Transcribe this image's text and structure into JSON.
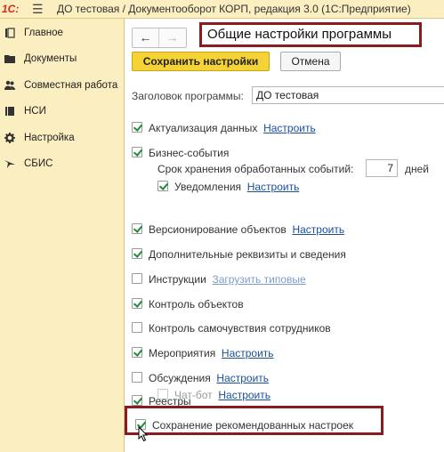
{
  "titlebar": {
    "logo": "1С:",
    "title": "ДО тестовая / Документооборот КОРП, редакция 3.0  (1С:Предприятие)"
  },
  "sidebar": {
    "items": [
      {
        "label": "Главное",
        "icon": "home-icon"
      },
      {
        "label": "Документы",
        "icon": "folder-icon"
      },
      {
        "label": "Совместная работа",
        "icon": "users-icon"
      },
      {
        "label": "НСИ",
        "icon": "reference-book-icon"
      },
      {
        "label": "Настройка",
        "icon": "gear-icon"
      },
      {
        "label": "СБИС",
        "icon": "sbis-icon"
      }
    ]
  },
  "page": {
    "title": "Общие настройки программы",
    "nav_back": "←",
    "nav_forward": "→",
    "save_label": "Сохранить настройки",
    "cancel_label": "Отмена",
    "program_title_label": "Заголовок программы:",
    "program_title_value": "ДО тестовая"
  },
  "options": {
    "actualization": {
      "label": "Актуализация данных",
      "link": "Настроить",
      "checked": true
    },
    "business_events": {
      "label": "Бизнес-события",
      "checked": true
    },
    "retention_label": "Срок хранения обработанных событий:",
    "retention_value": "7",
    "retention_unit": "дней",
    "notifications": {
      "label": "Уведомления",
      "link": "Настроить",
      "checked": true
    },
    "versioning": {
      "label": "Версионирование объектов",
      "link": "Настроить",
      "checked": true
    },
    "additional_props": {
      "label": "Дополнительные реквизиты и сведения",
      "checked": true
    },
    "instructions": {
      "label": "Инструкции",
      "link": "Загрузить типовые",
      "checked": false
    },
    "object_control": {
      "label": "Контроль объектов",
      "checked": true
    },
    "wellbeing": {
      "label": "Контроль самочувствия сотрудников",
      "checked": false
    },
    "events": {
      "label": "Мероприятия",
      "link": "Настроить",
      "checked": true
    },
    "discussions": {
      "label": "Обсуждения",
      "link": "Настроить",
      "checked": false
    },
    "chatbot": {
      "label": "Чат-бот",
      "link": "Настроить",
      "checked": false
    },
    "registries": {
      "label": "Реестры",
      "checked": true
    },
    "save_recommended": {
      "label": "Сохранение рекомендованных настроек",
      "checked": true
    }
  },
  "colors": {
    "sidebar_bg": "#fbeec0",
    "save_button": "#f5d336",
    "link": "#1a4f9c",
    "highlight_border": "#8a1c20",
    "check": "#1f8a3a"
  }
}
